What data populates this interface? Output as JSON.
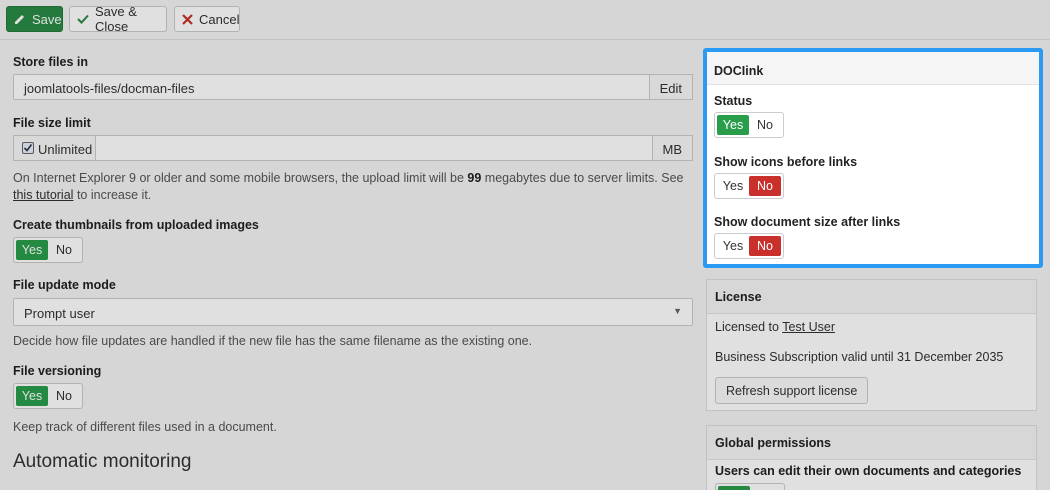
{
  "toolbar": {
    "save": "Save",
    "save_close": "Save & Close",
    "cancel": "Cancel",
    "colors": {
      "save_bg": "#2a8a45",
      "cancel_x": "#c9302c",
      "check": "#2a8a45"
    }
  },
  "form": {
    "store_files": {
      "label": "Store files in",
      "value": "joomlatools-files/docman-files",
      "button": "Edit"
    },
    "file_size": {
      "label": "File size limit",
      "checkbox_label": "Unlimited",
      "checked": true,
      "unit": "MB",
      "help_pre": "On Internet Explorer 9 or older and some mobile browsers, the upload limit will be",
      "help_num": "99",
      "help_mid": "megabytes due to server limits. See",
      "help_link": "this tutorial",
      "help_post": "to increase it."
    },
    "thumbnails": {
      "label": "Create thumbnails from uploaded images",
      "yes": "Yes",
      "no": "No",
      "value": "Yes"
    },
    "update_mode": {
      "label": "File update mode",
      "value": "Prompt user",
      "help": "Decide how file updates are handled if the new file has the same filename as the existing one."
    },
    "versioning": {
      "label": "File versioning",
      "yes": "Yes",
      "no": "No",
      "value": "Yes",
      "help": "Keep track of different files used in a document."
    },
    "section_heading": "Automatic monitoring"
  },
  "doclink": {
    "title": "DOCIink",
    "status": {
      "label": "Status",
      "yes": "Yes",
      "no": "No",
      "value": "Yes"
    },
    "show_icons": {
      "label": "Show icons before links",
      "yes": "Yes",
      "no": "No",
      "value": "No"
    },
    "show_size": {
      "label": "Show document size after links",
      "yes": "Yes",
      "no": "No",
      "value": "No"
    },
    "highlight_color": "#2b9af3"
  },
  "license": {
    "title": "License",
    "licensed_to_pre": "Licensed to",
    "licensed_to_user": "Test User",
    "subscription": "Business Subscription valid until 31 December 2035",
    "button": "Refresh support license"
  },
  "permissions": {
    "title": "Global permissions",
    "label": "Users can edit their own documents and categories"
  }
}
